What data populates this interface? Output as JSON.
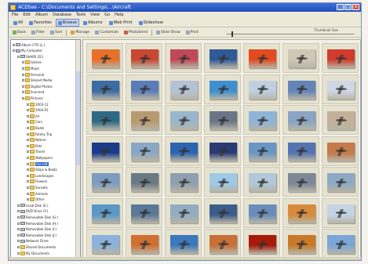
{
  "window": {
    "title": "ACDSee - C:\\Documents and Settings\\...\\Aircraft",
    "minimize_glyph": "_",
    "maximize_glyph": "□",
    "close_glyph": "x"
  },
  "menu": [
    "File",
    "Edit",
    "Album",
    "Database",
    "Tools",
    "View",
    "Go",
    "Help"
  ],
  "toolbar_modes": [
    {
      "label": "All",
      "icon": "all-icon"
    },
    {
      "label": "Favorites",
      "icon": "star-icon"
    },
    {
      "label": "Browse",
      "icon": "browse-icon",
      "active": true
    },
    {
      "label": "Albums",
      "icon": "album-icon"
    },
    {
      "label": "Web Print",
      "icon": "print-icon"
    },
    {
      "label": "Slideshow",
      "icon": "slideshow-icon"
    }
  ],
  "toolbar_actions": [
    {
      "label": "Back",
      "icon": "back-icon"
    },
    {
      "label": "Filter",
      "icon": "filter-icon"
    },
    {
      "label": "Sort",
      "icon": "sort-icon"
    },
    {
      "label": "Manage",
      "icon": "manage-icon"
    },
    {
      "label": "Customize",
      "icon": "customize-icon"
    },
    {
      "label": "PhotoSend",
      "icon": "send-icon"
    },
    {
      "label": "Slide Show",
      "icon": "slide-icon"
    },
    {
      "label": "Print",
      "icon": "print-icon"
    }
  ],
  "thumb_slider": {
    "label": "Thumbnail Size"
  },
  "tree": [
    {
      "label": "Album CTR (L:)",
      "type": "drive",
      "indent": 0
    },
    {
      "label": "My Computer",
      "type": "drive",
      "indent": 0
    },
    {
      "label": "SHARE (D:)",
      "type": "drive",
      "indent": 1
    },
    {
      "label": "Games",
      "type": "folder",
      "indent": 2
    },
    {
      "label": "Music",
      "type": "folder",
      "indent": 2
    },
    {
      "label": "Personal",
      "type": "folder",
      "indent": 2
    },
    {
      "label": "Shared Media",
      "type": "folder",
      "indent": 2
    },
    {
      "label": "Digital Photos",
      "type": "folder",
      "indent": 2
    },
    {
      "label": "Scanned",
      "type": "folder",
      "indent": 2
    },
    {
      "label": "Pictures",
      "type": "folder",
      "indent": 2
    },
    {
      "label": "2003-12",
      "type": "folder",
      "indent": 3
    },
    {
      "label": "2004-01",
      "type": "folder",
      "indent": 3
    },
    {
      "label": "Air",
      "type": "folder",
      "indent": 3
    },
    {
      "label": "Cars",
      "type": "folder",
      "indent": 3
    },
    {
      "label": "Boats",
      "type": "folder",
      "indent": 3
    },
    {
      "label": "Family Trip",
      "type": "folder",
      "indent": 3
    },
    {
      "label": "Nature",
      "type": "folder",
      "indent": 3
    },
    {
      "label": "Pets",
      "type": "folder",
      "indent": 3
    },
    {
      "label": "Travel",
      "type": "folder",
      "indent": 3
    },
    {
      "label": "Wallpapers",
      "type": "folder",
      "indent": 3
    },
    {
      "label": "Aircraft",
      "type": "folder",
      "indent": 3,
      "selected": true
    },
    {
      "label": "Ships & Boats",
      "type": "folder",
      "indent": 3
    },
    {
      "label": "Landscapes",
      "type": "folder",
      "indent": 3
    },
    {
      "label": "Flowers",
      "type": "folder",
      "indent": 3
    },
    {
      "label": "Sunsets",
      "type": "folder",
      "indent": 3
    },
    {
      "label": "Animals",
      "type": "folder",
      "indent": 3
    },
    {
      "label": "Other",
      "type": "folder",
      "indent": 3
    },
    {
      "label": "Local Disk (E:)",
      "type": "drive",
      "indent": 1
    },
    {
      "label": "DVD Drive (F:)",
      "type": "drive",
      "indent": 1
    },
    {
      "label": "Removable Disk (G:)",
      "type": "drive",
      "indent": 1
    },
    {
      "label": "Removable Disk (H:)",
      "type": "drive",
      "indent": 1
    },
    {
      "label": "Removable Disk (I:)",
      "type": "drive",
      "indent": 1
    },
    {
      "label": "Removable Disk (J:)",
      "type": "drive",
      "indent": 1
    },
    {
      "label": "Network Drive",
      "type": "drive",
      "indent": 1
    },
    {
      "label": "Shared Documents",
      "type": "folder",
      "indent": 1
    },
    {
      "label": "My Documents",
      "type": "folder",
      "indent": 1
    }
  ],
  "thumbnails": [
    [
      "#e8702a",
      "#c84832",
      "#c04858",
      "#2f5a96",
      "#e24a20",
      "#cfc6b6",
      "#d03c2e"
    ],
    [
      "#3c6ca4",
      "#5a7cb8",
      "#b4c2d6",
      "#3f8fd0",
      "#c0d0e0",
      "#6484b8",
      "#cfd6e4"
    ],
    [
      "#2e6a86",
      "#b89a70",
      "#9ab6cc",
      "#6a7686",
      "#8eb4d8",
      "#8aa4c4",
      "#c4b098"
    ],
    [
      "#1a3c8a",
      "#8aa8c6",
      "#2c64b0",
      "#2a3c76",
      "#6a96c4",
      "#5474b0",
      "#c47a4a"
    ],
    [
      "#7c9cc0",
      "#6a7a84",
      "#8ea0b0",
      "#9ecae8",
      "#b0c8d8",
      "#7c8896",
      "#8caac4"
    ],
    [
      "#5a98c8",
      "#5a7898",
      "#94acc0",
      "#3c5c8a",
      "#6a8cbc",
      "#d88a3a",
      "#c4d4e4"
    ],
    [
      "#8ab2dc",
      "#d07030",
      "#3c78bc",
      "#c87038",
      "#a81a0a",
      "#c87a28",
      "#7aa6d8"
    ]
  ]
}
